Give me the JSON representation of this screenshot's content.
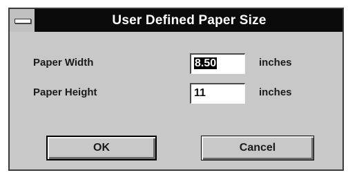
{
  "window": {
    "title": "User Defined Paper Size",
    "system_menu_icon": "system-menu-icon"
  },
  "fields": {
    "width": {
      "label": "Paper Width",
      "value": "8.50",
      "unit": "inches",
      "selected": true
    },
    "height": {
      "label": "Paper Height",
      "value": "11",
      "unit": "inches",
      "selected": false
    }
  },
  "buttons": {
    "ok": "OK",
    "cancel": "Cancel"
  }
}
